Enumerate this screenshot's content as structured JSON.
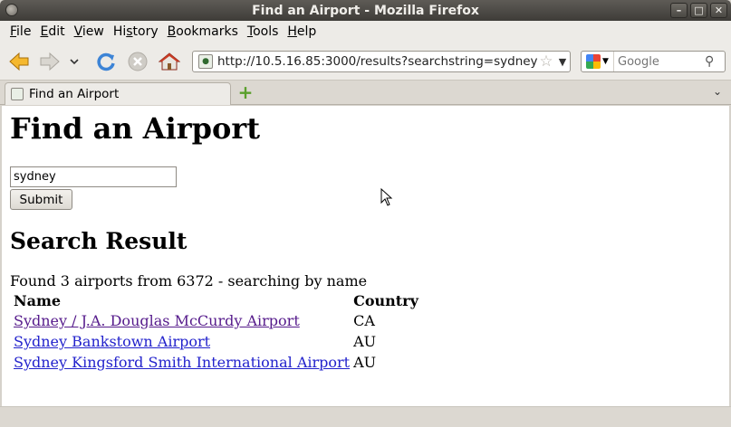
{
  "window": {
    "title": "Find an Airport - Mozilla Firefox"
  },
  "menubar": {
    "items": [
      {
        "label": "File",
        "mnemonic": "F",
        "rest": "ile"
      },
      {
        "label": "Edit",
        "mnemonic": "E",
        "rest": "dit"
      },
      {
        "label": "View",
        "mnemonic": "V",
        "rest": "iew"
      },
      {
        "label": "History",
        "mnemonic": "s",
        "pre": "Hi",
        "rest": "tory"
      },
      {
        "label": "Bookmarks",
        "mnemonic": "B",
        "rest": "ookmarks"
      },
      {
        "label": "Tools",
        "mnemonic": "T",
        "rest": "ools"
      },
      {
        "label": "Help",
        "mnemonic": "H",
        "rest": "elp"
      }
    ]
  },
  "navbar": {
    "url": "http://10.5.16.85:3000/results?searchstring=sydney",
    "search_placeholder": "Google"
  },
  "tabs": [
    {
      "label": "Find an Airport"
    }
  ],
  "page": {
    "heading": "Find an Airport",
    "search_value": "sydney",
    "submit_label": "Submit",
    "results_heading": "Search Result",
    "found_text": "Found 3 airports from 6372 - searching by name",
    "columns": [
      "Name",
      "Country"
    ],
    "rows": [
      {
        "name": "Sydney / J.A. Douglas McCurdy Airport",
        "country": "CA",
        "visited": true
      },
      {
        "name": "Sydney Bankstown Airport",
        "country": "AU",
        "visited": false
      },
      {
        "name": "Sydney Kingsford Smith International Airport",
        "country": "AU",
        "visited": false
      }
    ]
  },
  "colors": {
    "link": "#2222cc",
    "visited_link": "#551a8b"
  }
}
